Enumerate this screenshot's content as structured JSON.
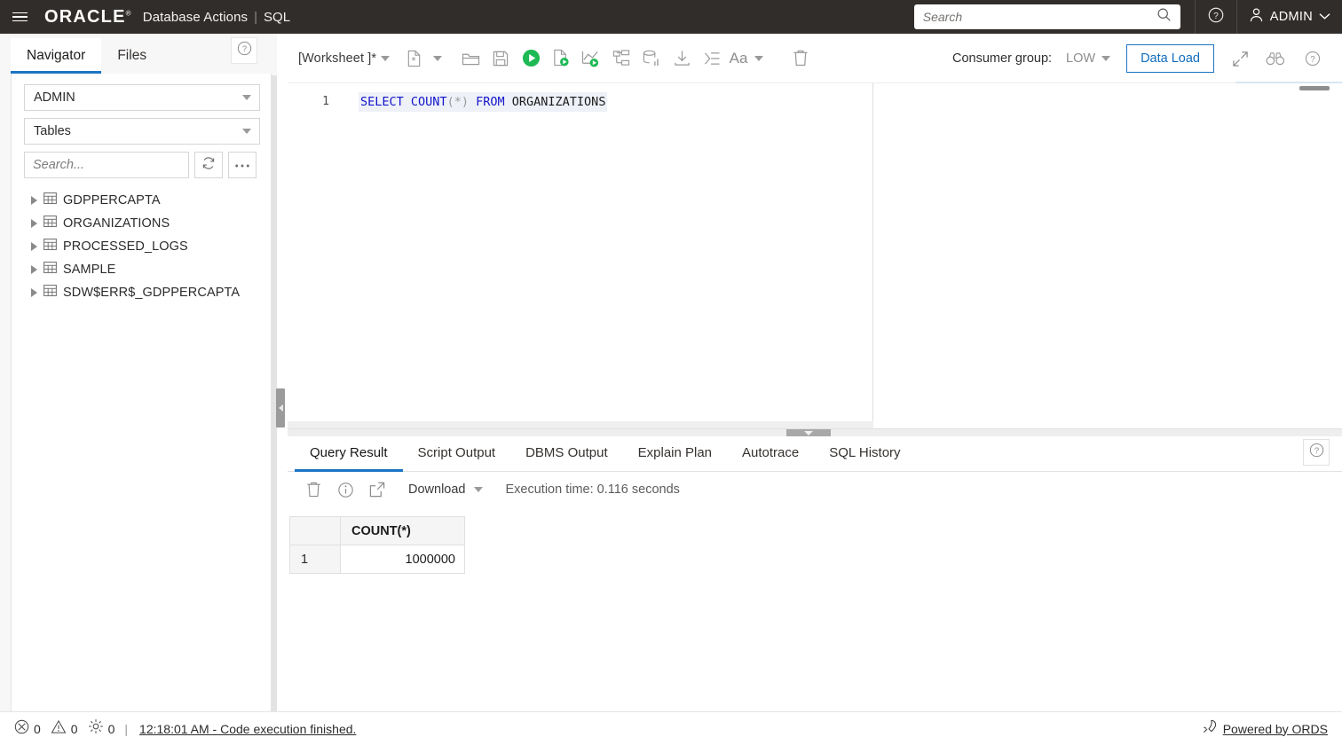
{
  "header": {
    "menu_icon": "hamburger-menu-icon",
    "brand": "ORACLE",
    "brand_reg": "®",
    "product": "Database Actions",
    "separator": "|",
    "module": "SQL",
    "search_placeholder": "Search",
    "search_value": "",
    "search_icon": "search-icon",
    "help_icon": "help-circle-icon",
    "user_icon": "user-avatar-icon",
    "user_name": "ADMIN",
    "user_caret_icon": "chevron-down-icon"
  },
  "sidebar": {
    "tabs": [
      {
        "label": "Navigator",
        "active": true
      },
      {
        "label": "Files",
        "active": false
      }
    ],
    "help_icon": "help-circle-icon",
    "schema_select": {
      "value": "ADMIN",
      "caret": "chevron-down-icon"
    },
    "object_select": {
      "value": "Tables",
      "caret": "chevron-down-icon"
    },
    "search_placeholder": "Search...",
    "search_value": "",
    "refresh_icon": "refresh-icon",
    "more_icon": "more-options-icon",
    "tree": [
      {
        "label": "GDPPERCAPTA",
        "icon": "table-icon"
      },
      {
        "label": "ORGANIZATIONS",
        "icon": "table-icon"
      },
      {
        "label": "PROCESSED_LOGS",
        "icon": "table-icon"
      },
      {
        "label": "SAMPLE",
        "icon": "table-icon"
      },
      {
        "label": "SDW$ERR$_GDPPERCAPTA",
        "icon": "table-icon"
      }
    ],
    "collapse_icon": "collapse-left-icon"
  },
  "worksheet": {
    "name": "[Worksheet ]*",
    "name_caret": "chevron-down-icon",
    "toolbar": [
      {
        "name": "new-worksheet-icon",
        "label": "New Worksheet"
      },
      {
        "name": "new-worksheet-caret-icon",
        "label": "New Worksheet Options"
      },
      {
        "name": "open-file-icon",
        "label": "Open File"
      },
      {
        "name": "save-icon",
        "label": "Save"
      },
      {
        "name": "run-statement-icon",
        "label": "Run Statement"
      },
      {
        "name": "run-script-icon",
        "label": "Run Script"
      },
      {
        "name": "explain-plan-icon",
        "label": "Explain Plan"
      },
      {
        "name": "autotrace-icon",
        "label": "Autotrace"
      },
      {
        "name": "sql-history-icon",
        "label": "SQL History"
      },
      {
        "name": "download-icon",
        "label": "Download"
      },
      {
        "name": "format-icon",
        "label": "Format"
      },
      {
        "name": "font-size-icon",
        "label": "Font Size"
      },
      {
        "name": "font-size-caret-icon",
        "label": "Font Size Options"
      },
      {
        "name": "clear-icon",
        "label": "Clear"
      }
    ],
    "consumer_group_label": "Consumer group:",
    "consumer_group_value": "LOW",
    "consumer_group_caret": "chevron-down-icon",
    "data_load_label": "Data Load",
    "expand_icon": "expand-icon",
    "find_icon": "binoculars-icon",
    "help_icon": "help-circle-icon"
  },
  "editor": {
    "line_number": "1",
    "sql": {
      "tok1": "SELECT",
      "tok2": "COUNT",
      "tok3": "(",
      "tok4": "*",
      "tok5": ")",
      "tok6": "FROM",
      "tok7": "ORGANIZATIONS"
    },
    "full_text": "SELECT COUNT(*) FROM ORGANIZATIONS"
  },
  "results": {
    "tabs": [
      {
        "label": "Query Result",
        "active": true
      },
      {
        "label": "Script Output",
        "active": false
      },
      {
        "label": "DBMS Output",
        "active": false
      },
      {
        "label": "Explain Plan",
        "active": false
      },
      {
        "label": "Autotrace",
        "active": false
      },
      {
        "label": "SQL History",
        "active": false
      }
    ],
    "help_icon": "help-circle-icon",
    "toolbar": {
      "clear_icon": "trash-icon",
      "info_icon": "info-circle-icon",
      "open-external_icon": "open-in-new-icon",
      "download_label": "Download",
      "download_caret": "chevron-down-icon",
      "execution_time": "Execution time: 0.116 seconds"
    },
    "grid": {
      "rownum_header": "",
      "columns": [
        "COUNT(*)"
      ],
      "rows": [
        {
          "num": "1",
          "values": [
            "1000000"
          ]
        }
      ]
    }
  },
  "statusbar": {
    "error_icon": "error-circle-icon",
    "error_count": "0",
    "warning_icon": "warning-triangle-icon",
    "warning_count": "0",
    "settings_icon": "gear-icon",
    "settings_count": "0",
    "pipe": "|",
    "message": "12:18:01 AM - Code execution finished.",
    "ords_icon": "rocket-icon",
    "ords_label": "Powered by ORDS"
  },
  "colors": {
    "header_bg": "#312d2a",
    "accent_blue": "#1b74c4",
    "run_green": "#1db954",
    "keyword_blue": "#1414cc"
  }
}
